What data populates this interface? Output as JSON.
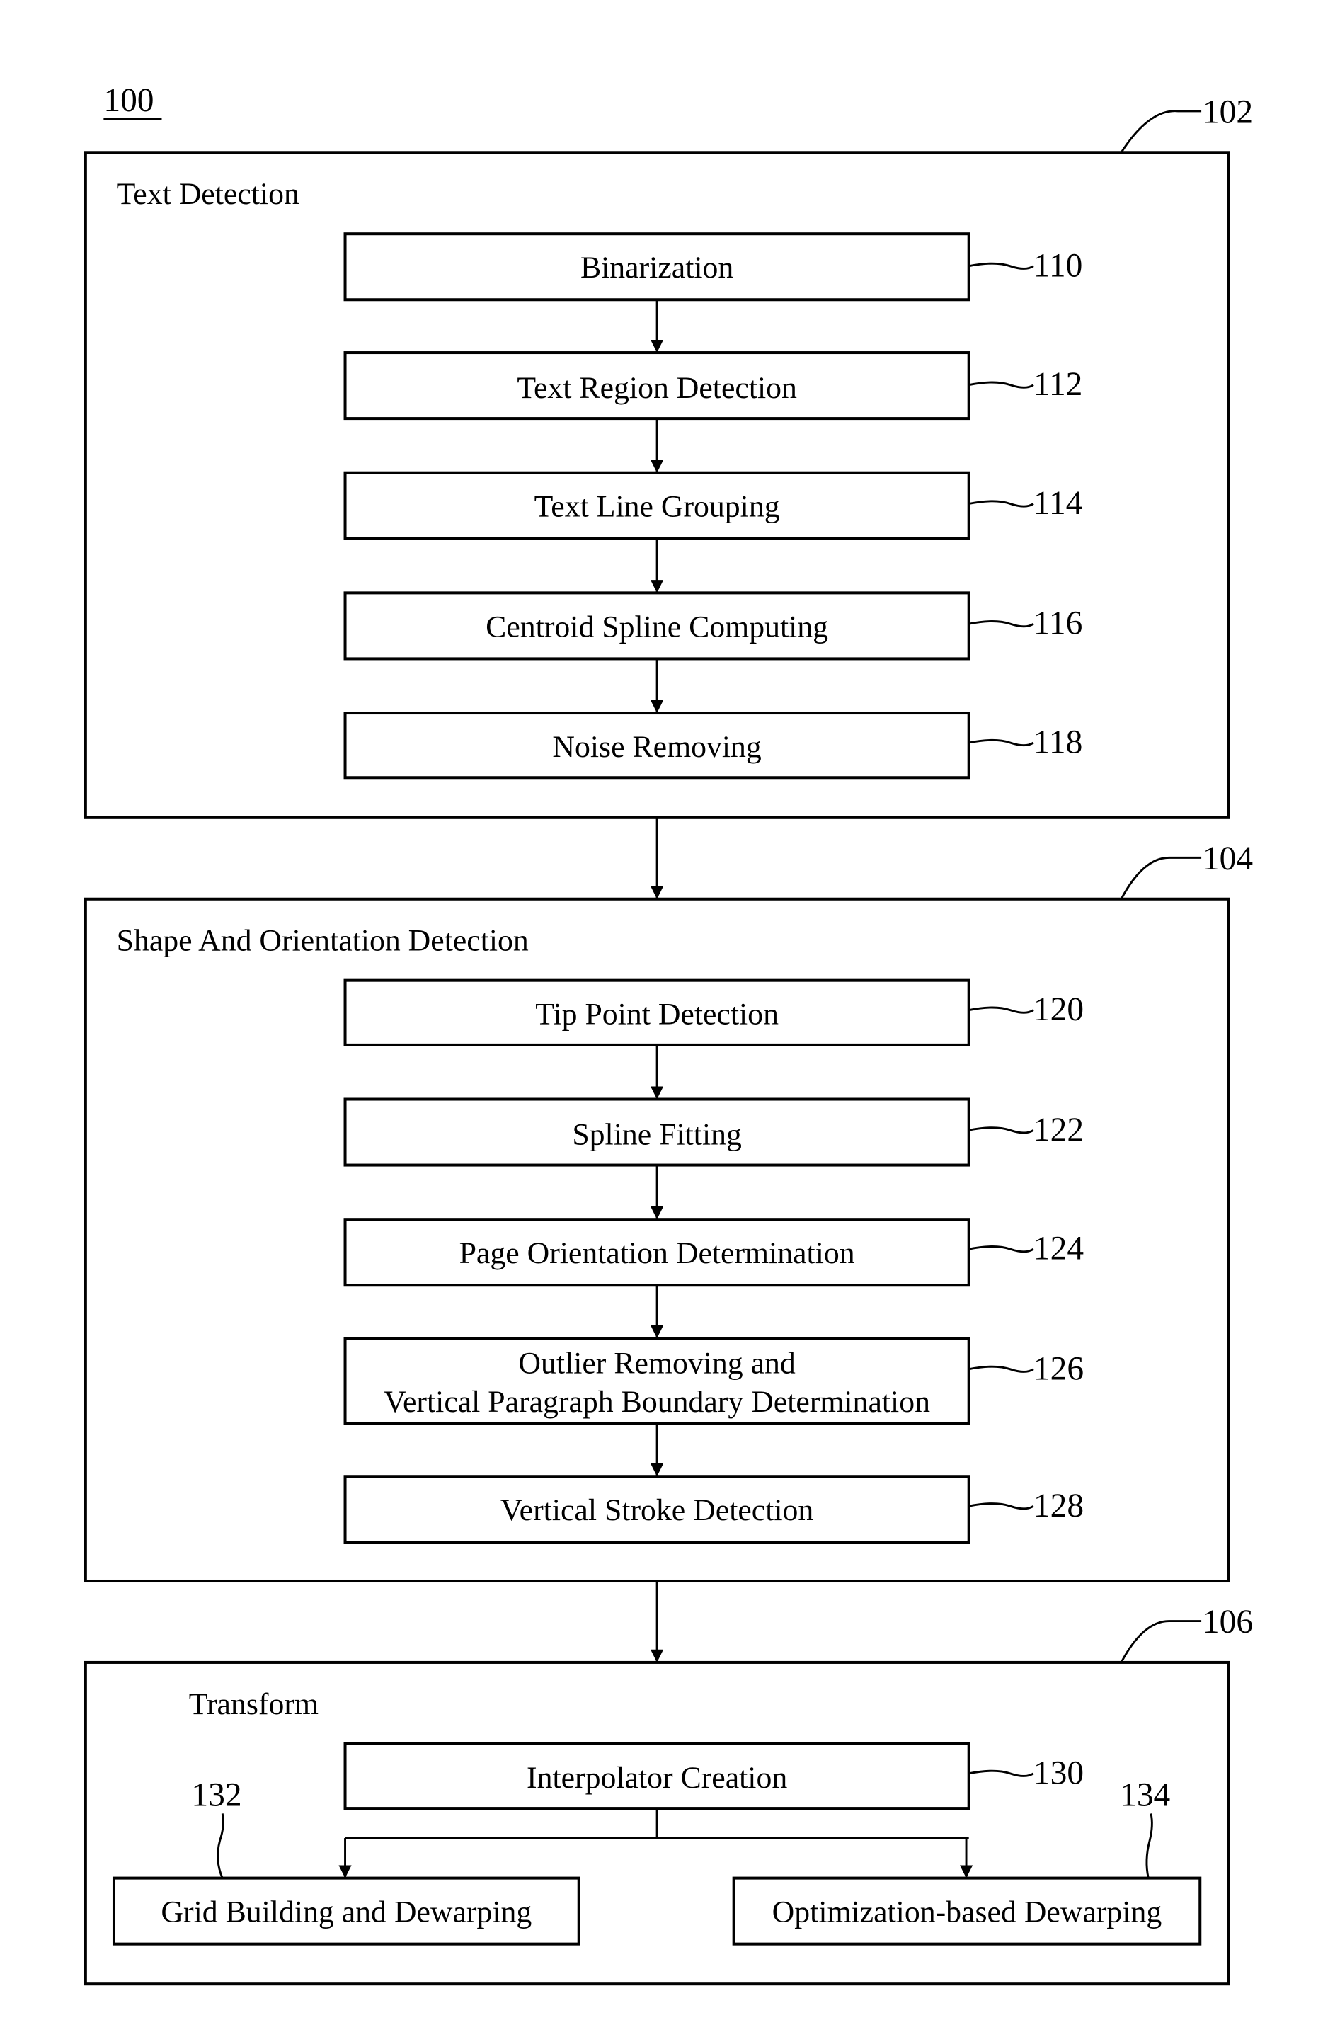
{
  "figure": {
    "id_label": "100",
    "groups": [
      {
        "ref": "102",
        "title": "Text Detection",
        "steps": [
          {
            "ref": "110",
            "lines": [
              "Binarization"
            ]
          },
          {
            "ref": "112",
            "lines": [
              "Text Region Detection"
            ]
          },
          {
            "ref": "114",
            "lines": [
              "Text Line Grouping"
            ]
          },
          {
            "ref": "116",
            "lines": [
              "Centroid Spline Computing"
            ]
          },
          {
            "ref": "118",
            "lines": [
              "Noise Removing"
            ]
          }
        ]
      },
      {
        "ref": "104",
        "title": "Shape And Orientation Detection",
        "steps": [
          {
            "ref": "120",
            "lines": [
              "Tip Point Detection"
            ]
          },
          {
            "ref": "122",
            "lines": [
              "Spline Fitting"
            ]
          },
          {
            "ref": "124",
            "lines": [
              "Page Orientation Determination"
            ]
          },
          {
            "ref": "126",
            "lines": [
              "Outlier Removing and",
              "Vertical Paragraph Boundary Determination"
            ]
          },
          {
            "ref": "128",
            "lines": [
              "Vertical Stroke Detection"
            ]
          }
        ]
      },
      {
        "ref": "106",
        "title": "Transform",
        "steps": [
          {
            "ref": "130",
            "lines": [
              "Interpolator Creation"
            ]
          },
          {
            "ref": "132",
            "lines": [
              "Grid Building and Dewarping"
            ]
          },
          {
            "ref": "134",
            "lines": [
              "Optimization-based Dewarping"
            ]
          }
        ]
      }
    ]
  }
}
